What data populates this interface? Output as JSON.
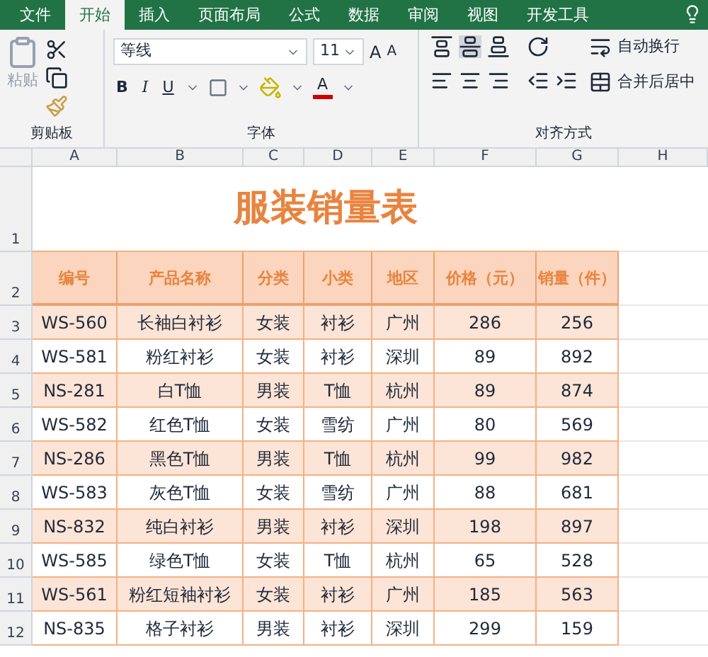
{
  "tabs": [
    {
      "label": "文件",
      "selected": false
    },
    {
      "label": "开始",
      "selected": true
    },
    {
      "label": "插入",
      "selected": false
    },
    {
      "label": "页面布局",
      "selected": false
    },
    {
      "label": "公式",
      "selected": false
    },
    {
      "label": "数据",
      "selected": false
    },
    {
      "label": "审阅",
      "selected": false
    },
    {
      "label": "视图",
      "selected": false
    },
    {
      "label": "开发工具",
      "selected": false
    }
  ],
  "ribbon": {
    "clipboard": {
      "paste": "粘贴",
      "group": "剪贴板"
    },
    "font": {
      "name": "等线",
      "size": "11",
      "bold": "B",
      "italic": "I",
      "underline": "U",
      "grow": "A",
      "shrink": "A",
      "font_color_glyph": "A",
      "group": "字体"
    },
    "alignment": {
      "wrap": "自动换行",
      "merge": "合并后居中",
      "group": "对齐方式"
    }
  },
  "sheet": {
    "columns": [
      "A",
      "B",
      "C",
      "D",
      "E",
      "F",
      "G",
      "H"
    ],
    "title_row": "1",
    "title": "服装销量表",
    "header_row": "2",
    "headers": [
      "编号",
      "产品名称",
      "分类",
      "小类",
      "地区",
      "价格（元）",
      "销量（件）"
    ],
    "rows": [
      {
        "row": "3",
        "highlighted": true,
        "cells": [
          "WS-560",
          "长袖白衬衫",
          "女装",
          "衬衫",
          "广州",
          "286",
          "256"
        ]
      },
      {
        "row": "4",
        "highlighted": false,
        "cells": [
          "WS-581",
          "粉红衬衫",
          "女装",
          "衬衫",
          "深圳",
          "89",
          "892"
        ]
      },
      {
        "row": "5",
        "highlighted": true,
        "cells": [
          "NS-281",
          "白T恤",
          "男装",
          "T恤",
          "杭州",
          "89",
          "874"
        ]
      },
      {
        "row": "6",
        "highlighted": false,
        "cells": [
          "WS-582",
          "红色T恤",
          "女装",
          "雪纺",
          "广州",
          "80",
          "569"
        ]
      },
      {
        "row": "7",
        "highlighted": true,
        "cells": [
          "NS-286",
          "黑色T恤",
          "男装",
          "T恤",
          "杭州",
          "99",
          "982"
        ]
      },
      {
        "row": "8",
        "highlighted": false,
        "cells": [
          "WS-583",
          "灰色T恤",
          "女装",
          "雪纺",
          "广州",
          "88",
          "681"
        ]
      },
      {
        "row": "9",
        "highlighted": true,
        "cells": [
          "NS-832",
          "纯白衬衫",
          "男装",
          "衬衫",
          "深圳",
          "198",
          "897"
        ]
      },
      {
        "row": "10",
        "highlighted": false,
        "cells": [
          "WS-585",
          "绿色T恤",
          "女装",
          "T恤",
          "杭州",
          "65",
          "528"
        ]
      },
      {
        "row": "11",
        "highlighted": true,
        "cells": [
          "WS-561",
          "粉红短袖衬衫",
          "女装",
          "衬衫",
          "广州",
          "185",
          "563"
        ]
      },
      {
        "row": "12",
        "highlighted": false,
        "cells": [
          "NS-835",
          "格子衬衫",
          "男装",
          "衬衫",
          "深圳",
          "299",
          "159"
        ]
      }
    ]
  }
}
